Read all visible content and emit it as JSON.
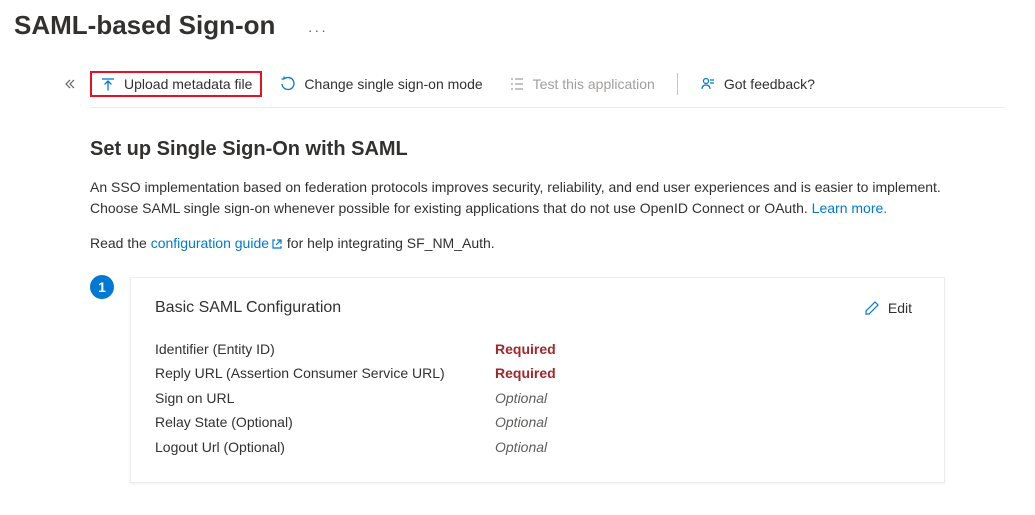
{
  "header": {
    "title": "SAML-based Sign-on",
    "ellipsis": "···"
  },
  "toolbar": {
    "upload_label": "Upload metadata file",
    "change_mode_label": "Change single sign-on mode",
    "test_label": "Test this application",
    "feedback_label": "Got feedback?"
  },
  "section": {
    "title": "Set up Single Sign-On with SAML",
    "description_part1": "An SSO implementation based on federation protocols improves security, reliability, and end user experiences and is easier to implement. Choose SAML single sign-on whenever possible for existing applications that do not use OpenID Connect or OAuth. ",
    "learn_more": "Learn more.",
    "guide_prefix": "Read the ",
    "guide_link": "configuration guide",
    "guide_suffix": " for help integrating SF_NM_Auth."
  },
  "card": {
    "step": "1",
    "title": "Basic SAML Configuration",
    "edit_label": "Edit",
    "rows": [
      {
        "label": "Identifier (Entity ID)",
        "value": "Required",
        "kind": "required"
      },
      {
        "label": "Reply URL (Assertion Consumer Service URL)",
        "value": "Required",
        "kind": "required"
      },
      {
        "label": "Sign on URL",
        "value": "Optional",
        "kind": "optional"
      },
      {
        "label": "Relay State (Optional)",
        "value": "Optional",
        "kind": "optional"
      },
      {
        "label": "Logout Url (Optional)",
        "value": "Optional",
        "kind": "optional"
      }
    ]
  }
}
